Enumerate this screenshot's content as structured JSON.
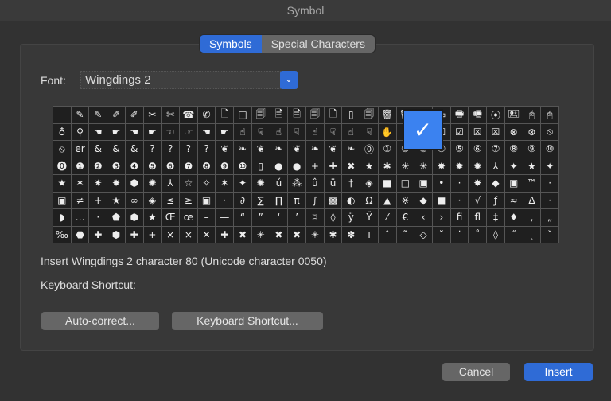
{
  "window": {
    "title": "Symbol"
  },
  "tabs": [
    {
      "label": "Symbols",
      "active": true
    },
    {
      "label": "Special Characters",
      "active": false
    }
  ],
  "font": {
    "label": "Font:",
    "value": "Wingdings 2"
  },
  "grid": {
    "rows": [
      [
        "",
        "✎",
        "✎",
        "✐",
        "✐",
        "✂",
        "✄",
        "☎",
        "✆",
        "🗋",
        "□",
        "🗐",
        "🗎",
        "🗎",
        "🗐",
        "🗋",
        "▯",
        "🗐",
        "🗑",
        "🗑",
        "▭",
        "▭",
        "🖶",
        "🖷",
        "⦿",
        "🖭",
        "🖰",
        "🖰"
      ],
      [
        "♁",
        "⚲",
        "☚",
        "☛",
        "☚",
        "☛",
        "☜",
        "☞",
        "☚",
        "☛",
        "☝",
        "☟",
        "☝",
        "☟",
        "☝",
        "☟",
        "☝",
        "☟",
        "✋",
        "✓",
        "✗",
        "☐",
        "☑",
        "☒",
        "☒",
        "⊗",
        "⊗",
        "⦸"
      ],
      [
        "⦸",
        "er",
        "&",
        "&",
        "&",
        "?",
        "?",
        "?",
        "?",
        "❦",
        "❧",
        "❦",
        "❧",
        "❦",
        "❧",
        "❦",
        "❧",
        "⓪",
        "①",
        "②",
        "③",
        "④",
        "⑤",
        "⑥",
        "⑦",
        "⑧",
        "⑨",
        "⑩"
      ],
      [
        "⓿",
        "❶",
        "❷",
        "❸",
        "❹",
        "❺",
        "❻",
        "❼",
        "❽",
        "❾",
        "❿",
        "▯",
        "●",
        "●",
        "+",
        "✚",
        "✖",
        "★",
        "✱",
        "✳",
        "✳",
        "✸",
        "✹",
        "✹",
        "⅄",
        "✦",
        "★",
        "✦"
      ],
      [
        "★",
        "✶",
        "✷",
        "✸",
        "⬢",
        "✺",
        "⅄",
        "☆",
        "✧",
        "✶",
        "✦",
        "✺",
        "ú",
        "⁂",
        "û",
        "ü",
        "†",
        "◈",
        "■",
        "□",
        "▣",
        "•",
        "·",
        "✸",
        "◆",
        "▣",
        "™",
        "·"
      ],
      [
        "▣",
        "≠",
        "+",
        "★",
        "∞",
        "◈",
        "≤",
        "≥",
        "▣",
        "·",
        "∂",
        "∑",
        "∏",
        "π",
        "∫",
        "▩",
        "◐",
        "Ω",
        "▲",
        "※",
        "◆",
        "■",
        "·",
        "√",
        "ƒ",
        "≈",
        "Δ",
        "·"
      ],
      [
        "◗",
        "…",
        "·",
        "⬟",
        "⬢",
        "★",
        "Œ",
        "œ",
        "–",
        "—",
        "“",
        "”",
        "‘",
        "’",
        "⌑",
        "◊",
        "ÿ",
        "Ÿ",
        "⁄",
        "€",
        "‹",
        "›",
        "ﬁ",
        "ﬂ",
        "‡",
        "♦",
        "‚",
        "„"
      ],
      [
        "‰",
        "⬣",
        "✚",
        "⬢",
        "✚",
        "+",
        "×",
        "×",
        "✕",
        "✚",
        "✖",
        "✳",
        "✖",
        "✖",
        "✳",
        "✱",
        "✽",
        "ı",
        "ˆ",
        "˜",
        "◇",
        "˘",
        "˙",
        "˚",
        "◊",
        "˝",
        "˛",
        "ˇ"
      ]
    ],
    "selected_glyph": "✓"
  },
  "description": "Insert Wingdings 2 character 80 (Unicode character 0050)",
  "shortcut_label": "Keyboard Shortcut:",
  "buttons": {
    "autocorrect": "Auto-correct...",
    "keyboard_shortcut": "Keyboard Shortcut...",
    "cancel": "Cancel",
    "insert": "Insert"
  },
  "colors": {
    "accent": "#2f6bd6",
    "selection": "#3b82f0"
  }
}
